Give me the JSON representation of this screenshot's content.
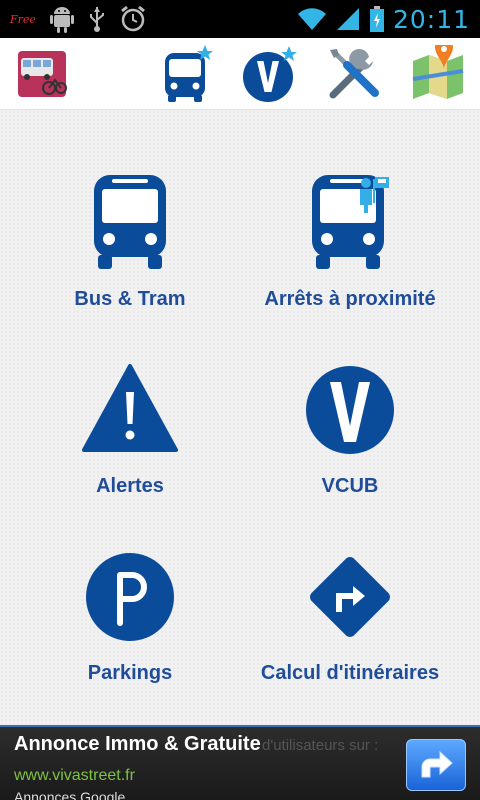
{
  "status_bar": {
    "free_label": "Free",
    "time": "20:11",
    "icons": [
      "android-icon",
      "usb-icon",
      "alarm-icon",
      "wifi-icon",
      "signal-icon",
      "battery-icon"
    ]
  },
  "toolbar": {
    "items": [
      {
        "name": "app-logo-icon"
      },
      {
        "name": "bus-favorite-icon"
      },
      {
        "name": "vcub-favorite-icon"
      },
      {
        "name": "settings-tools-icon"
      },
      {
        "name": "map-icon"
      }
    ]
  },
  "menu": {
    "bus_tram": "Bus & Tram",
    "nearby_stops": "Arrêts à proximité",
    "alerts": "Alertes",
    "vcub": "VCUB",
    "parkings": "Parkings",
    "itinerary": "Calcul d'itinéraires"
  },
  "ad": {
    "title": "Annonce Immo & Gratuite",
    "ghost_text": "d'utilisateurs sur :",
    "url": "www.vivastreet.fr",
    "source": "Annonces Google"
  },
  "colors": {
    "accent_blue": "#0a4b9a",
    "label_blue": "#1f4d99",
    "clock_blue": "#33b5e5",
    "ad_url_green": "#7dc242"
  }
}
